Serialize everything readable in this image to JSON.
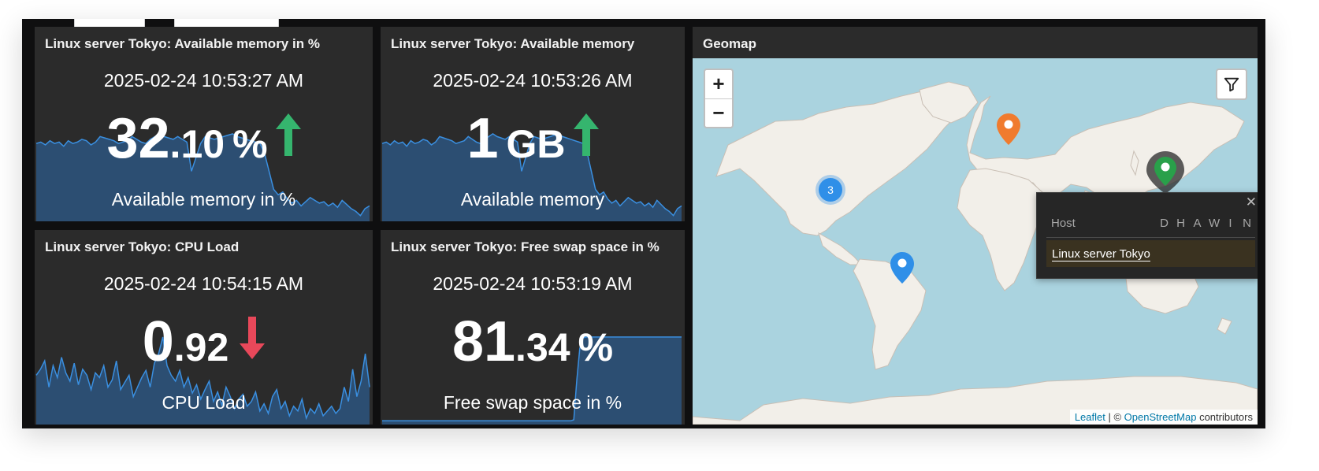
{
  "widgets": [
    {
      "title": "Linux server Tokyo: Available memory in %",
      "time": "2025-02-24 10:53:27 AM",
      "value_int": "32",
      "value_dec": ".10",
      "unit": "%",
      "trend": "up",
      "description": "Available memory in %",
      "sparkline": [
        55,
        56,
        54,
        57,
        55,
        56,
        53,
        57,
        55,
        56,
        58,
        57,
        54,
        56,
        60,
        59,
        58,
        57,
        55,
        56,
        57,
        60,
        58,
        56,
        55,
        58,
        60,
        62,
        60,
        59,
        58,
        60,
        58,
        56,
        35,
        45,
        55,
        60,
        59,
        58,
        59,
        60,
        61,
        62,
        60,
        59,
        58,
        57,
        56,
        55,
        48,
        35,
        22,
        18,
        20,
        15,
        12,
        14,
        10,
        13,
        16,
        14,
        12,
        13,
        10,
        12,
        9,
        14,
        11,
        8,
        6,
        3,
        8,
        10
      ]
    },
    {
      "title": "Linux server Tokyo: Available memory",
      "time": "2025-02-24 10:53:26 AM",
      "value_int": "1",
      "value_dec": "",
      "unit": "GB",
      "trend": "up",
      "description": "Available memory",
      "sparkline": [
        55,
        56,
        54,
        57,
        55,
        56,
        53,
        57,
        55,
        56,
        58,
        57,
        54,
        56,
        60,
        59,
        58,
        57,
        55,
        56,
        57,
        60,
        58,
        56,
        55,
        58,
        60,
        62,
        60,
        59,
        58,
        60,
        58,
        56,
        35,
        45,
        55,
        60,
        59,
        58,
        59,
        60,
        61,
        62,
        60,
        59,
        58,
        57,
        56,
        55,
        48,
        35,
        22,
        18,
        20,
        15,
        12,
        14,
        10,
        13,
        16,
        14,
        12,
        13,
        10,
        12,
        9,
        14,
        11,
        8,
        6,
        3,
        8,
        10
      ]
    },
    {
      "title": "Linux server Tokyo: CPU Load",
      "time": "2025-02-24 10:54:15 AM",
      "value_int": "0",
      "value_dec": ".92",
      "unit": "",
      "trend": "down",
      "description": "CPU Load",
      "sparkline": [
        40,
        45,
        52,
        30,
        48,
        38,
        55,
        42,
        35,
        50,
        32,
        45,
        40,
        28,
        42,
        38,
        48,
        30,
        36,
        52,
        28,
        34,
        40,
        22,
        30,
        38,
        44,
        30,
        50,
        58,
        72,
        48,
        40,
        35,
        44,
        30,
        38,
        25,
        32,
        20,
        28,
        35,
        18,
        26,
        15,
        30,
        22,
        12,
        20,
        24,
        14,
        18,
        26,
        10,
        16,
        8,
        22,
        28,
        12,
        18,
        6,
        14,
        10,
        20,
        4,
        12,
        8,
        16,
        6,
        10,
        14,
        8,
        12,
        30,
        18,
        45,
        22,
        35,
        58,
        30
      ]
    },
    {
      "title": "Linux server Tokyo: Free swap space in %",
      "time": "2025-02-24 10:53:19 AM",
      "value_int": "81",
      "value_dec": ".34",
      "unit": "%",
      "trend": "",
      "description": "Free swap space in %",
      "sparkline": [
        2,
        2,
        2,
        2,
        2,
        2,
        2,
        2,
        2,
        2,
        2,
        2,
        2,
        2,
        2,
        2,
        2,
        2,
        2,
        2,
        2,
        2,
        2,
        2,
        2,
        2,
        2,
        2,
        2,
        2,
        2,
        2,
        2,
        2,
        2,
        2,
        2,
        2,
        2,
        2,
        2,
        2,
        2,
        2,
        2,
        2,
        2,
        2,
        2,
        2,
        2,
        2,
        2,
        2,
        2,
        2,
        2,
        2,
        2,
        2,
        2,
        2,
        2,
        2,
        3,
        40,
        70,
        80,
        81,
        81,
        81,
        81,
        81,
        81,
        81,
        81,
        81,
        81,
        81,
        81,
        81,
        81,
        81,
        81,
        81,
        81,
        81,
        81,
        81,
        81,
        81,
        81,
        81,
        81,
        81,
        81,
        81,
        81,
        81,
        81,
        81
      ]
    }
  ],
  "geomap": {
    "title": "Geomap",
    "zoom_in": "+",
    "zoom_out": "−",
    "cluster_count": "3",
    "popup": {
      "close": "✕",
      "col_host": "Host",
      "severity_cols": [
        "D",
        "H",
        "A",
        "W",
        "I",
        "N"
      ],
      "host": "Linux server Tokyo"
    },
    "attribution": {
      "leaflet": "Leaflet",
      "sep": " | © ",
      "osm": "OpenStreetMap",
      "suffix": " contributors"
    }
  },
  "colors": {
    "spark_fill": "#2c4e72",
    "spark_line": "#3a8fe0",
    "trend_up": "#35b56e",
    "trend_down": "#e8485a",
    "land": "#f2efe9",
    "water": "#aad3df",
    "marker_cluster": "#2f8fe8",
    "marker_europe": "#f07b2e",
    "marker_brazil": "#2f8fe8",
    "marker_tokyo": "#29a04a"
  }
}
